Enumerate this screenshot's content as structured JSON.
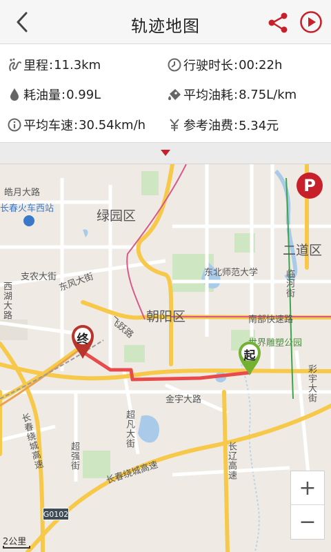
{
  "header": {
    "title": "轨迹地图",
    "back_icon": "chevron-left-icon",
    "share_icon": "share-icon",
    "play_icon": "play-icon",
    "accent_color": "#c8202a"
  },
  "stats": {
    "mileage": {
      "label": "里程",
      "value": "11.3km"
    },
    "duration": {
      "label": "行驶时长",
      "value": "00:22h"
    },
    "fuel": {
      "label": "耗油量",
      "value": "0.99L"
    },
    "avg_fuel": {
      "label": "平均油耗",
      "value": "8.75L/km"
    },
    "avg_speed": {
      "label": "平均车速",
      "value": "30.54km/h"
    },
    "cost": {
      "label": "参考油费",
      "value": "5.34元"
    }
  },
  "map": {
    "parking_label": "P",
    "start_label": "起",
    "end_label": "终",
    "zoom_in": "+",
    "zoom_out": "−",
    "scale": "2公里",
    "highway_badge": "G0102",
    "labels": {
      "haoyue": "皓月大路",
      "changchun_west": "长春火车西站",
      "lvyuan": "绿园区",
      "erdao": "二道区",
      "zhinong": "支农大街",
      "dongfeng": "东风大街",
      "xihu": "西湖大路",
      "dongbei": "东北师范大学",
      "linhe": "临河街",
      "chaoyang": "朝阳区",
      "nanbu": "南部快速路",
      "feiyue": "飞跃路",
      "sculpture": "世界雕塑公园",
      "jinyu": "金宇大路",
      "caiyu": "彩宇大街",
      "changchun_ring_v": "长春绕城高速",
      "chaofan": "超凡大街",
      "chaoqiang": "超强街",
      "ring": "长春绕城高速",
      "changliao": "长辽高速"
    }
  }
}
